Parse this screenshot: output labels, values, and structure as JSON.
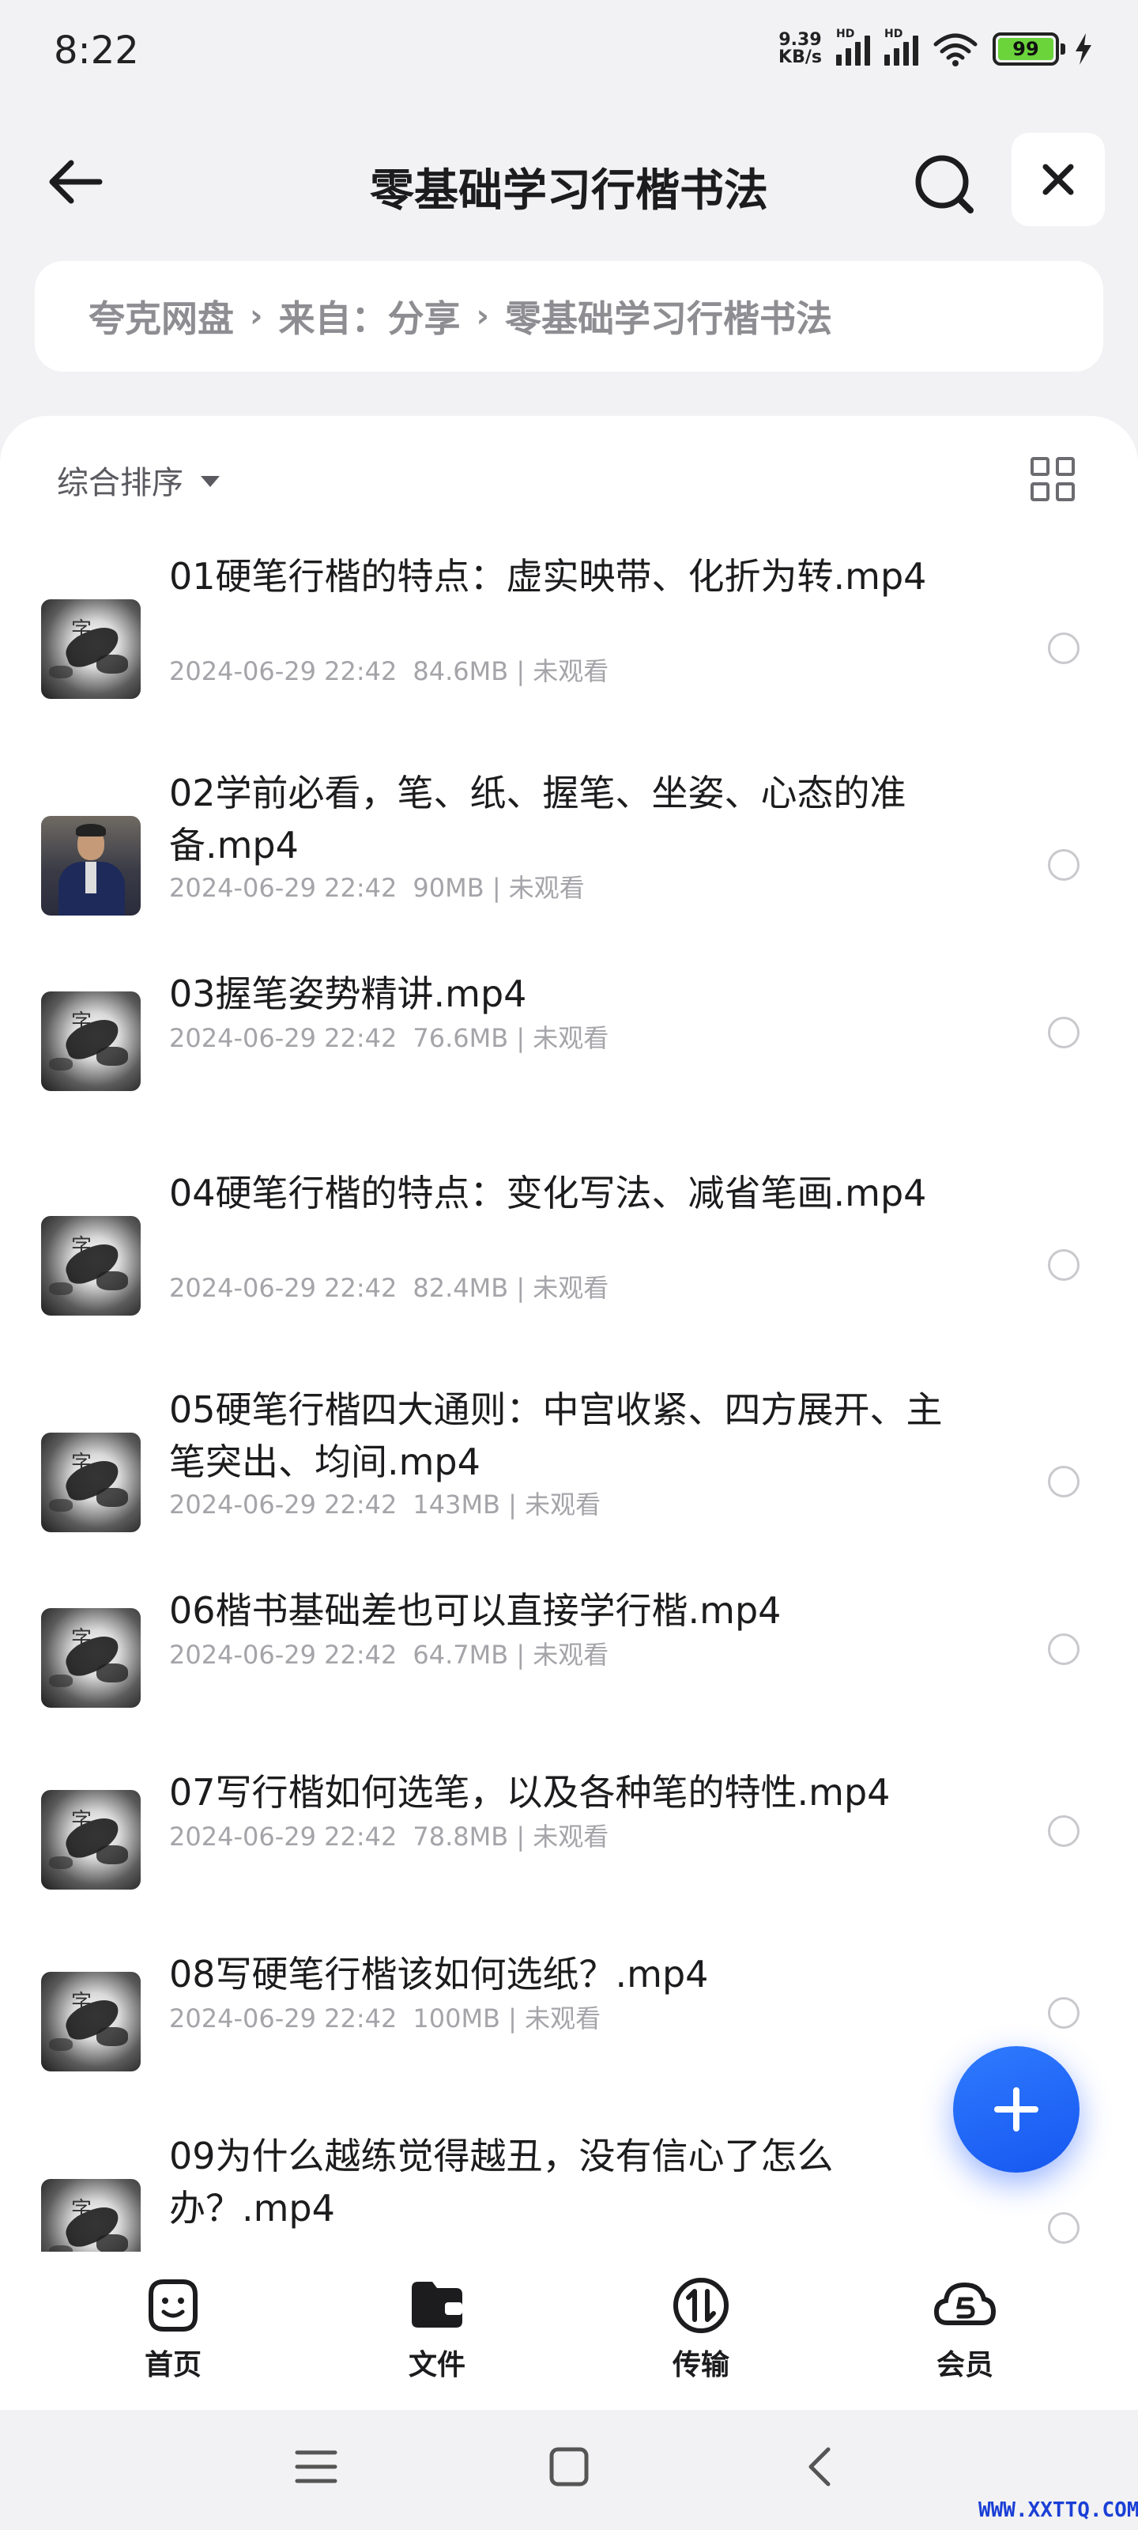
{
  "status_bar": {
    "time": "8:22",
    "net_speed_value": "9.39",
    "net_speed_unit": "KB/s",
    "signal1_label": "HD",
    "signal2_label": "HD",
    "battery": "99"
  },
  "header": {
    "title": "零基础学习行楷书法"
  },
  "breadcrumb": {
    "items": [
      "夸克网盘",
      "来自：分享",
      "零基础学习行楷书法"
    ],
    "separator": "›"
  },
  "toolbar": {
    "sort_label": "综合排序"
  },
  "files": [
    {
      "name": "01硬笔行楷的特点：虚实映带、化折为转.mp4",
      "date": "2024-06-29 22:42",
      "size": "84.6MB",
      "status": "未观看",
      "thumb": "calligraphy"
    },
    {
      "name": "02学前必看，笔、纸、握笔、坐姿、心态的准备.mp4",
      "date": "2024-06-29 22:42",
      "size": "90MB",
      "status": "未观看",
      "thumb": "person"
    },
    {
      "name": "03握笔姿势精讲.mp4",
      "date": "2024-06-29 22:42",
      "size": "76.6MB",
      "status": "未观看",
      "thumb": "calligraphy"
    },
    {
      "name": "04硬笔行楷的特点：变化写法、减省笔画.mp4",
      "date": "2024-06-29 22:42",
      "size": "82.4MB",
      "status": "未观看",
      "thumb": "calligraphy"
    },
    {
      "name": "05硬笔行楷四大通则：中宫收紧、四方展开、主笔突出、均间.mp4",
      "date": "2024-06-29 22:42",
      "size": "143MB",
      "status": "未观看",
      "thumb": "calligraphy"
    },
    {
      "name": "06楷书基础差也可以直接学行楷.mp4",
      "date": "2024-06-29 22:42",
      "size": "64.7MB",
      "status": "未观看",
      "thumb": "calligraphy"
    },
    {
      "name": "07写行楷如何选笔，以及各种笔的特性.mp4",
      "date": "2024-06-29 22:42",
      "size": "78.8MB",
      "status": "未观看",
      "thumb": "calligraphy"
    },
    {
      "name": "08写硬笔行楷该如何选纸？.mp4",
      "date": "2024-06-29 22:42",
      "size": "100MB",
      "status": "未观看",
      "thumb": "calligraphy"
    },
    {
      "name": "09为什么越练觉得越丑，没有信心了怎么办？.mp4",
      "date": "",
      "size": "",
      "status": "",
      "thumb": "calligraphy"
    }
  ],
  "bottom_nav": [
    {
      "label": "首页",
      "icon": "home-face-icon"
    },
    {
      "label": "文件",
      "icon": "folder-icon"
    },
    {
      "label": "传输",
      "icon": "transfer-icon"
    },
    {
      "label": "会员",
      "icon": "vip-cloud-icon"
    }
  ],
  "thumb_glyph": "字",
  "watermark": "WWW.XXTTQ.COM",
  "colors": {
    "accent": "#1a62ff",
    "background": "#f2f2f4",
    "meta_text": "#a4a4a9"
  }
}
